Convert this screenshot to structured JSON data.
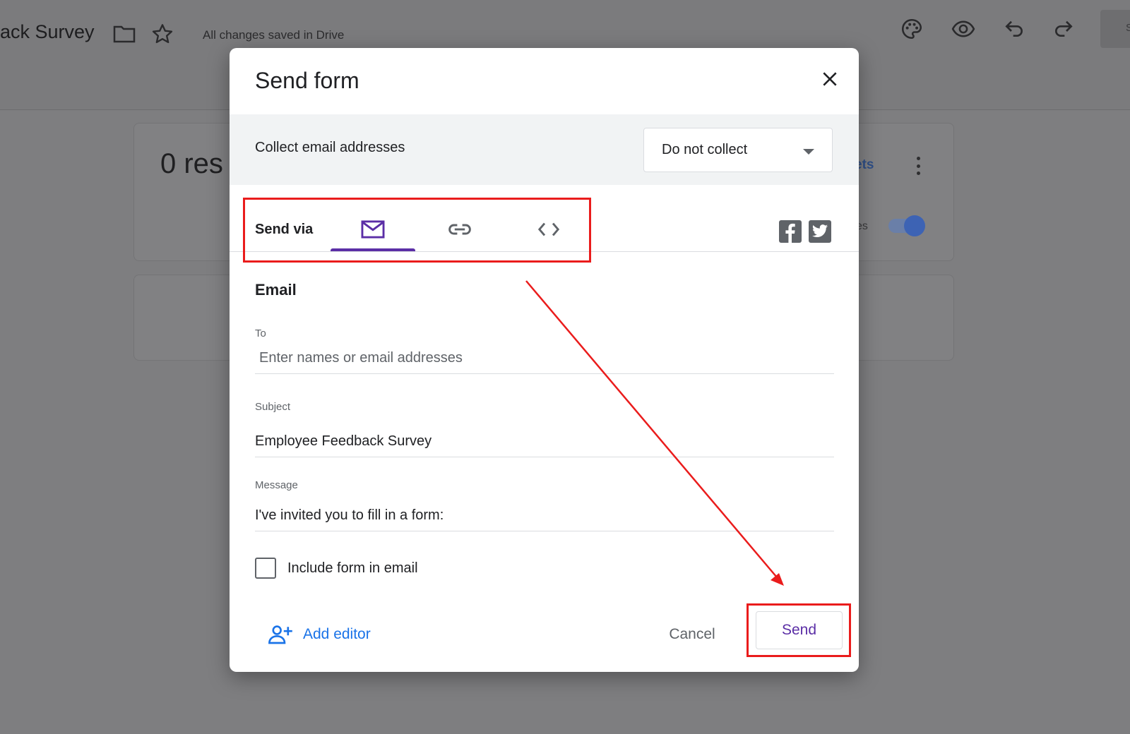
{
  "app": {
    "doc_title": "ack Survey",
    "saved_status": "All changes saved in Drive",
    "right_button_partial": "S"
  },
  "background": {
    "responses_partial": "0 res",
    "link_partial": "ets",
    "toggle_label_partial": "es",
    "toggle_on": true
  },
  "dialog": {
    "title": "Send form",
    "collect_label": "Collect email addresses",
    "collect_select_value": "Do not collect",
    "send_via_label": "Send via",
    "tabs": [
      {
        "name": "email",
        "icon": "email-icon",
        "active": true
      },
      {
        "name": "link",
        "icon": "link-icon",
        "active": false
      },
      {
        "name": "embed",
        "icon": "code-icon",
        "active": false
      }
    ],
    "share_icons": [
      "facebook-icon",
      "twitter-icon"
    ],
    "section_title": "Email",
    "to": {
      "label": "To",
      "placeholder": "Enter names or email addresses",
      "value": ""
    },
    "subject": {
      "label": "Subject",
      "value": "Employee Feedback Survey"
    },
    "message": {
      "label": "Message",
      "value": "I've invited you to fill in a form:"
    },
    "include_form": {
      "label": "Include form in email",
      "checked": false
    },
    "add_editor_label": "Add editor",
    "cancel_label": "Cancel",
    "send_label": "Send"
  },
  "colors": {
    "accent": "#5b2ea6",
    "link_blue": "#1a73e8",
    "annotation_red": "#ea1c1c",
    "overlay": "#7e7e80"
  }
}
